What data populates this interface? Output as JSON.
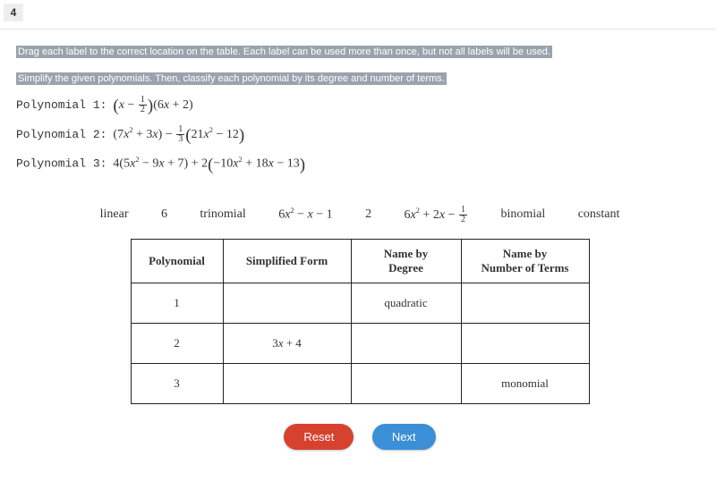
{
  "question_number": "4",
  "instruction_line1": "Drag each label to the correct location on the table. Each label can be used more than once, but not all labels will be used.",
  "instruction_line2": "Simplify the given polynomials. Then, classify each polynomial by its degree and number of terms.",
  "polynomials": {
    "p1": {
      "label": "Polynomial 1:"
    },
    "p2": {
      "label": "Polynomial 2:"
    },
    "p3": {
      "label": "Polynomial 3:"
    }
  },
  "labels": {
    "l1": "linear",
    "l2": "6",
    "l3": "trinomial",
    "l5": "2",
    "l7": "binomial",
    "l8": "constant"
  },
  "table": {
    "headers": {
      "h1": "Polynomial",
      "h2": "Simplified Form",
      "h3": "Name by\nDegree",
      "h4": "Name by\nNumber of Terms"
    },
    "rows": {
      "r1": {
        "polynomial": "1",
        "simplified": "",
        "degree": "quadratic",
        "terms": ""
      },
      "r2": {
        "polynomial": "2",
        "simplified": "3x + 4",
        "degree": "",
        "terms": ""
      },
      "r3": {
        "polynomial": "3",
        "simplified": "",
        "degree": "",
        "terms": "monomial"
      }
    }
  },
  "buttons": {
    "reset": "Reset",
    "next": "Next"
  }
}
